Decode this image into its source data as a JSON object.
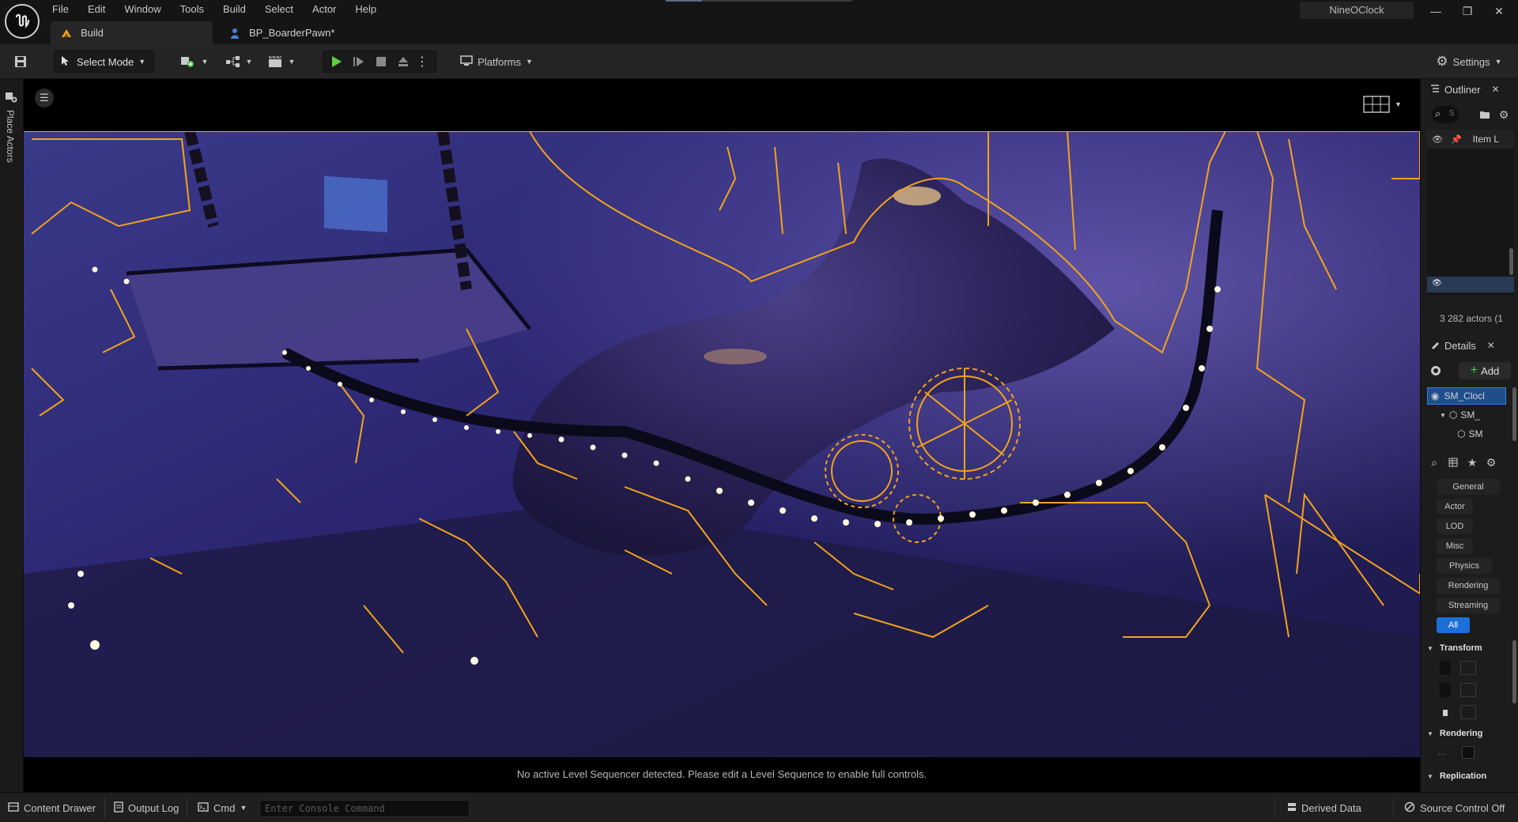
{
  "menu": [
    "File",
    "Edit",
    "Window",
    "Tools",
    "Build",
    "Select",
    "Actor",
    "Help"
  ],
  "project_name": "NineOClock",
  "window_controls": {
    "minimize": "—",
    "restore": "❐",
    "close": "✕"
  },
  "tabs": [
    {
      "label": "Build",
      "icon": "level-icon",
      "active": true
    },
    {
      "label": "BP_BoarderPawn*",
      "icon": "pawn-icon",
      "active": false
    }
  ],
  "toolbar": {
    "select_mode": "Select Mode",
    "platforms": "Platforms",
    "settings": "Settings"
  },
  "left_rail": {
    "place_actors": "Place Actors"
  },
  "viewport": {
    "sequencer_message": "No active Level Sequencer detected. Please edit a Level Sequence to enable full controls."
  },
  "outliner": {
    "title": "Outliner",
    "close": "✕",
    "header_label": "Item L",
    "search_hint": "S",
    "actor_count": "3 282 actors (1"
  },
  "details": {
    "title": "Details",
    "close": "✕",
    "add_label": "Add",
    "components": [
      "SM_Clocl",
      "SM_",
      "SM"
    ],
    "categories": [
      "General",
      "Actor",
      "LOD",
      "Misc",
      "Physics",
      "Rendering",
      "Streaming",
      "All"
    ],
    "sections": [
      "Transform",
      "Rendering",
      "Replication"
    ],
    "rendering_value": "..."
  },
  "statusbar": {
    "content_drawer": "Content Drawer",
    "output_log": "Output Log",
    "cmd": "Cmd",
    "console_placeholder": "Enter Console Command",
    "derived_data": "Derived Data",
    "source_control": "Source Control Off"
  },
  "colors": {
    "accent_orange": "#f2a31b",
    "scene_purple": "#2e2a6e",
    "selection_blue": "#1c6fd8",
    "play_green": "#5fcf3c"
  }
}
